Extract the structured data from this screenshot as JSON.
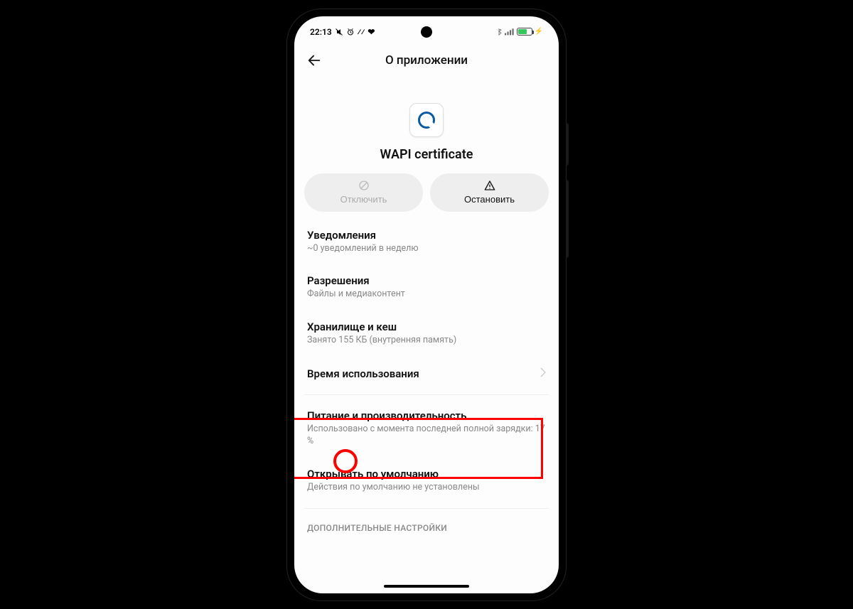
{
  "status": {
    "time": "22:13",
    "icons_left": [
      "mute",
      "alarm",
      "misc1",
      "misc2"
    ],
    "icons_right": [
      "bluetooth",
      "signal",
      "battery",
      "charging"
    ]
  },
  "header": {
    "title": "О приложении"
  },
  "app": {
    "name": "WAPI certificate"
  },
  "actions": {
    "disable": "Отключить",
    "stop": "Остановить"
  },
  "items": [
    {
      "title": "Уведомления",
      "sub": "~0 уведомлений в неделю"
    },
    {
      "title": "Разрешения",
      "sub": "Файлы и медиаконтент"
    },
    {
      "title": "Хранилище и кеш",
      "sub": "Занято 155 КБ (внутренняя память)"
    },
    {
      "title": "Время использования",
      "sub": ""
    },
    {
      "title": "Питание и производительность",
      "sub": "Использовано с момента последней полной зарядки: 17 %"
    },
    {
      "title": "Открывать по умолчанию",
      "sub": "Действия по умолчанию не установлены"
    }
  ],
  "section_header": "ДОПОЛНИТЕЛЬНЫЕ НАСТРОЙКИ",
  "highlight": {
    "item_index": 4,
    "circle_text_target": "17 %"
  }
}
